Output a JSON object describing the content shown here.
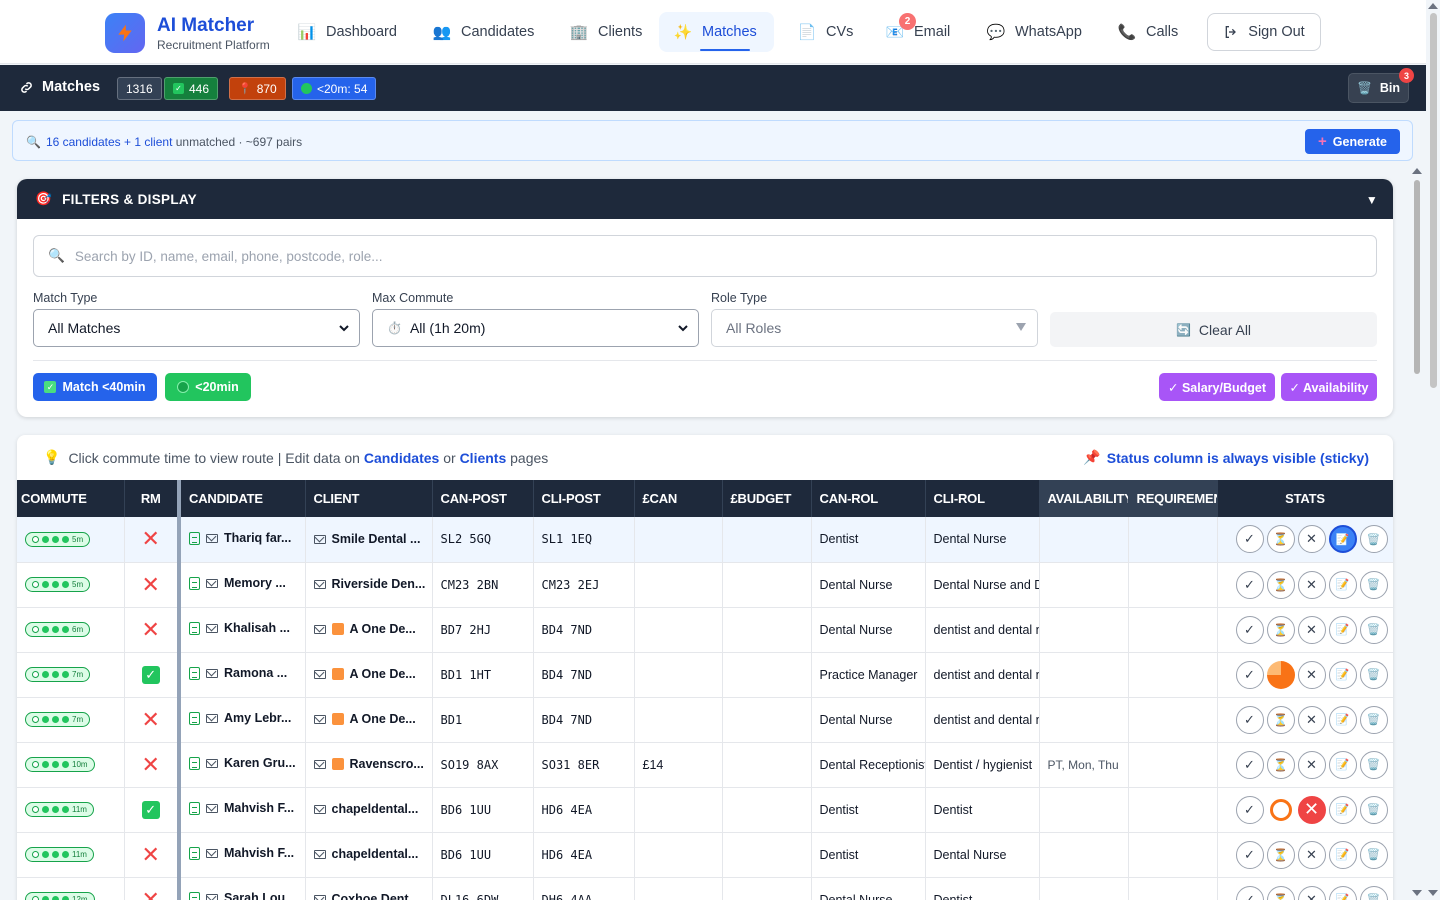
{
  "brand": {
    "title": "AI Matcher",
    "subtitle": "Recruitment Platform"
  },
  "nav": {
    "items": [
      {
        "label": "Dashboard",
        "icon": "bar-chart-icon"
      },
      {
        "label": "Candidates",
        "icon": "people-icon"
      },
      {
        "label": "Clients",
        "icon": "building-icon"
      },
      {
        "label": "Matches",
        "icon": "sparkles-icon",
        "active": true
      },
      {
        "label": "CVs",
        "icon": "document-icon"
      },
      {
        "label": "Email",
        "icon": "email-icon",
        "badge": "2"
      },
      {
        "label": "WhatsApp",
        "icon": "chat-bubble-icon"
      },
      {
        "label": "Calls",
        "icon": "phone-icon"
      }
    ],
    "signout_label": "Sign Out"
  },
  "matchbar": {
    "title": "Matches",
    "total": "1316",
    "ok_count": "446",
    "pin_count": "870",
    "under20": "<20m: 54",
    "bin_label": "Bin",
    "bin_badge": "3"
  },
  "unmatched": {
    "candidates": "16 candidates",
    "plus": " + ",
    "client": "1 client",
    "rest": " unmatched · ~697 pairs",
    "generate_label": "Generate"
  },
  "filters": {
    "title": "FILTERS & DISPLAY",
    "search_placeholder": "Search by ID, name, email, phone, postcode, role...",
    "match_type_label": "Match Type",
    "match_type_value": "All Matches",
    "max_commute_label": "Max Commute",
    "max_commute_value": "All (1h 20m)",
    "role_type_label": "Role Type",
    "role_type_value": "All Roles",
    "clear_label": "Clear All",
    "pill_match40": "Match <40min",
    "pill_20min": "<20min",
    "pill_salary": "✓ Salary/Budget",
    "pill_availability": "✓ Availability"
  },
  "table": {
    "hint_pre": "Click commute time to view route | Edit data on ",
    "hint_candidates": "Candidates",
    "hint_or": " or ",
    "hint_clients": "Clients",
    "hint_post": " pages",
    "sticky_note": "Status column is always visible (sticky)",
    "headers": [
      "COMMUTE",
      "RM",
      "CANDIDATE",
      "CLIENT",
      "CAN-POST",
      "CLI-POST",
      "£CAN",
      "£BUDGET",
      "CAN-ROL",
      "CLI-ROL",
      "AVAILABILITY",
      "REQUIREMENTS",
      "STATS"
    ],
    "rows": [
      {
        "commute": "5m",
        "rm": "x",
        "candidate": "Thariq far...",
        "client": "Smile Dental ...",
        "client_flag": false,
        "can_post": "SL2 5GQ",
        "cli_post": "SL1 1EQ",
        "can_sal": "",
        "budget": "",
        "can_rol": "Dentist",
        "cli_rol": "Dental Nurse",
        "availability": "",
        "requirements": "",
        "status": "blue"
      },
      {
        "commute": "5m",
        "rm": "x",
        "candidate": "Memory ...",
        "client": "Riverside Den...",
        "client_flag": false,
        "can_post": "CM23 2BN",
        "cli_post": "CM23 2EJ",
        "can_sal": "",
        "budget": "",
        "can_rol": "Dental Nurse",
        "cli_rol": "Dental Nurse and D",
        "availability": "",
        "requirements": "",
        "status": "normal"
      },
      {
        "commute": "6m",
        "rm": "x",
        "candidate": "Khalisah ...",
        "client": "A One De...",
        "client_flag": true,
        "can_post": "BD7 2HJ",
        "cli_post": "BD4 7ND",
        "can_sal": "",
        "budget": "",
        "can_rol": "Dental Nurse",
        "cli_rol": "dentist and dental n",
        "availability": "",
        "requirements": "",
        "status": "normal"
      },
      {
        "commute": "7m",
        "rm": "ok",
        "candidate": "Ramona ...",
        "client": "A One De...",
        "client_flag": true,
        "can_post": "BD1 1HT",
        "cli_post": "BD4 7ND",
        "can_sal": "",
        "budget": "",
        "can_rol": "Practice Manager",
        "cli_rol": "dentist and dental n",
        "availability": "",
        "requirements": "",
        "status": "pie"
      },
      {
        "commute": "7m",
        "rm": "x",
        "candidate": "Amy Lebr...",
        "client": "A One De...",
        "client_flag": true,
        "can_post": "BD1",
        "cli_post": "BD4 7ND",
        "can_sal": "",
        "budget": "",
        "can_rol": "Dental Nurse",
        "cli_rol": "dentist and dental n",
        "availability": "",
        "requirements": "",
        "status": "normal"
      },
      {
        "commute": "10m",
        "rm": "x",
        "candidate": "Karen Gru...",
        "client": "Ravenscro...",
        "client_flag": true,
        "can_post": "SO19 8AX",
        "cli_post": "SO31 8ER",
        "can_sal": "£14",
        "budget": "",
        "can_rol": "Dental Receptionist",
        "cli_rol": "Dentist / hygienist",
        "availability": "PT, Mon, Thu",
        "requirements": "",
        "status": "normal"
      },
      {
        "commute": "11m",
        "rm": "ok",
        "candidate": "Mahvish F...",
        "client": "chapeldental...",
        "client_flag": false,
        "can_post": "BD6 1UU",
        "cli_post": "HD6 4EA",
        "can_sal": "",
        "budget": "",
        "can_rol": "Dentist",
        "cli_rol": "Dentist",
        "availability": "",
        "requirements": "",
        "status": "rejected"
      },
      {
        "commute": "11m",
        "rm": "x",
        "candidate": "Mahvish F...",
        "client": "chapeldental...",
        "client_flag": false,
        "can_post": "BD6 1UU",
        "cli_post": "HD6 4EA",
        "can_sal": "",
        "budget": "",
        "can_rol": "Dentist",
        "cli_rol": "Dental Nurse",
        "availability": "",
        "requirements": "",
        "status": "normal"
      },
      {
        "commute": "12m",
        "rm": "x",
        "candidate": "Sarah Lou...",
        "client": "Coxhoe Dent...",
        "client_flag": false,
        "can_post": "DL16 6DW",
        "cli_post": "DH6 4AA",
        "can_sal": "",
        "budget": "",
        "can_rol": "Dental Nurse",
        "cli_rol": "Dentist",
        "availability": "",
        "requirements": "",
        "status": "normal"
      }
    ]
  },
  "colors": {
    "accent": "#2563eb",
    "dark_bar": "#1e293b",
    "green": "#22c55e",
    "red": "#ef4444",
    "purple": "#a855f7",
    "orange": "#f97316"
  }
}
